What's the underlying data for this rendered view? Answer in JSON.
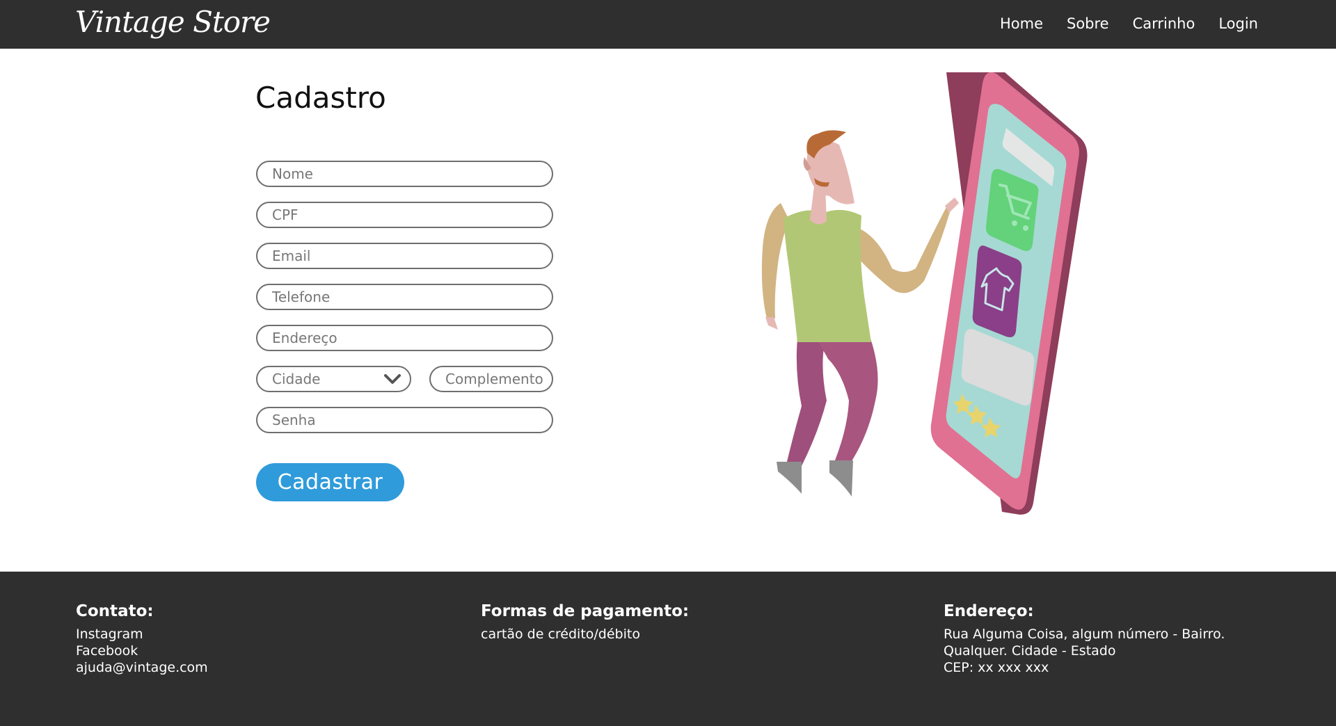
{
  "header": {
    "brand": "Vintage Store",
    "nav": [
      "Home",
      "Sobre",
      "Carrinho",
      "Login"
    ]
  },
  "form": {
    "title": "Cadastro",
    "fields": {
      "nome": "Nome",
      "cpf": "CPF",
      "email": "Email",
      "telefone": "Telefone",
      "endereco": "Endereço",
      "cidade": "Cidade",
      "complemento": "Complemento",
      "senha": "Senha"
    },
    "submit_label": "Cadastrar"
  },
  "illustration": {
    "icons": [
      "shopping-cart-icon",
      "shirt-icon",
      "star-icon"
    ]
  },
  "footer": {
    "contato": {
      "heading": "Contato:",
      "lines": [
        "Instagram",
        "Facebook",
        "ajuda@vintage.com"
      ]
    },
    "pagamento": {
      "heading": "Formas de pagamento:",
      "lines": [
        "cartão de crédito/débito"
      ]
    },
    "endereco": {
      "heading": "Endereço:",
      "lines": [
        "Rua Alguma Coisa, algum número - Bairro.",
        "Qualquer. Cidade - Estado",
        "CEP: xx xxx xxx"
      ]
    }
  },
  "colors": {
    "header_bg": "#2f2f2f",
    "button": "#2f9bdb",
    "phone": "#e07192",
    "screen": "#a6d9d3"
  }
}
